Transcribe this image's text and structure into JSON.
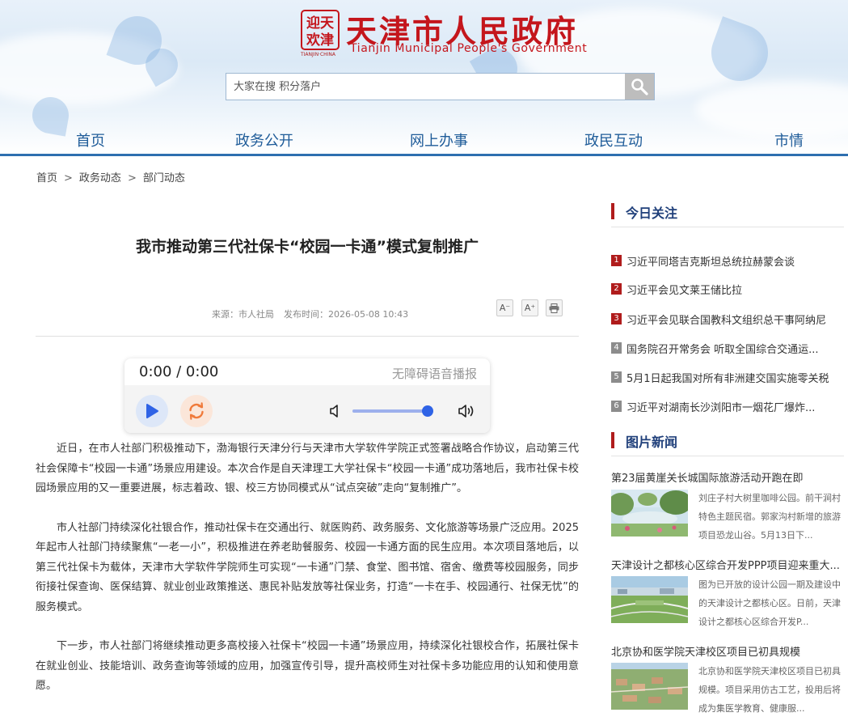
{
  "header": {
    "seal_chars": [
      "天",
      "津",
      "欢",
      "迎"
    ],
    "seal_caption": "TIANJIN·CHINA",
    "title": "天津市人民政府",
    "subtitle": "Tianjin Municipal People's Government"
  },
  "search": {
    "placeholder": "大家在搜 积分落户"
  },
  "nav": {
    "items": [
      "首页",
      "政务公开",
      "网上办事",
      "政民互动",
      "市情"
    ]
  },
  "breadcrumb": {
    "items": [
      "首页",
      "政务动态",
      "部门动态"
    ],
    "separator": ">"
  },
  "article": {
    "title": "我市推动第三代社保卡“校园一卡通”模式复制推广",
    "source": "来源：市人社局",
    "published": "发布时间：2026-05-08 10:43",
    "tools": {
      "font_down": "A⁻",
      "font_up": "A⁺"
    },
    "paragraphs": [
      "近日，在市人社部门积极推动下，渤海银行天津分行与天津市大学软件学院正式签署战略合作协议，启动第三代社会保障卡“校园一卡通”场景应用建设。本次合作是自天津理工大学社保卡“校园一卡通”成功落地后，我市社保卡校园场景应用的又一重要进展，标志着政、银、校三方协同模式从“试点突破”走向“复制推广”。",
      "市人社部门持续深化社银合作，推动社保卡在交通出行、就医购药、政务服务、文化旅游等场景广泛应用。2025年起市人社部门持续聚焦“一老一小”，积极推进在养老助餐服务、校园一卡通方面的民生应用。本次项目落地后，以第三代社保卡为载体，天津市大学软件学院师生可实现“一卡通”门禁、食堂、图书馆、宿舍、缴费等校园服务，同步衔接社保查询、医保结算、就业创业政策推送、惠民补贴发放等社保业务，打造“一卡在手、校园通行、社保无忧”的服务模式。",
      "下一步，市人社部门将继续推动更多高校接入社保卡“校园一卡通”场景应用，持续深化社银校合作，拓展社保卡在就业创业、技能培训、政务查询等领域的应用，加强宣传引导，提升高校师生对社保卡多功能应用的认知和使用意愿。"
    ]
  },
  "audio": {
    "time": "0:00 / 0:00",
    "label": "无障碍语音播报",
    "volume": 0.93
  },
  "sidebar": {
    "focus": {
      "title": "今日关注",
      "items": [
        {
          "num": "1",
          "text": "习近平同塔吉克斯坦总统拉赫蒙会谈",
          "style": "red"
        },
        {
          "num": "2",
          "text": "习近平会见文莱王储比拉",
          "style": "red"
        },
        {
          "num": "3",
          "text": "习近平会见联合国教科文组织总干事阿纳尼",
          "style": "red"
        },
        {
          "num": "4",
          "text": "国务院召开常务会 听取全国综合交通运...",
          "style": "gray"
        },
        {
          "num": "5",
          "text": "5月1日起我国对所有非洲建交国实施零关税",
          "style": "gray"
        },
        {
          "num": "6",
          "text": "习近平对湖南长沙浏阳市一烟花厂爆炸...",
          "style": "gray"
        }
      ]
    },
    "pictures": {
      "title": "图片新闻",
      "items": [
        {
          "title": "第23届黄崖关长城国际旅游活动开跑在即",
          "desc": "刘庄子村大树里咖啡公园。前干涧村特色主题民宿。郭家沟村新增的旅游项目恐龙山谷。5月13日下..."
        },
        {
          "title": "天津设计之都核心区综合开发PPP项目迎来重大...",
          "desc": "图为已开放的设计公园一期及建设中的天津设计之都核心区。日前，天津设计之都核心区综合开发P..."
        },
        {
          "title": "北京协和医学院天津校区项目已初具规模",
          "desc": "北京协和医学院天津校区项目已初具规模。项目采用仿古工艺，投用后将成为集医学教育、健康服..."
        }
      ]
    }
  },
  "colors": {
    "brand_red": "#c4161c",
    "nav_blue": "#1f5c99",
    "sidebar_title": "#1f3f7a",
    "player_blue": "#2f63e6",
    "player_orange": "#f07a3a"
  }
}
